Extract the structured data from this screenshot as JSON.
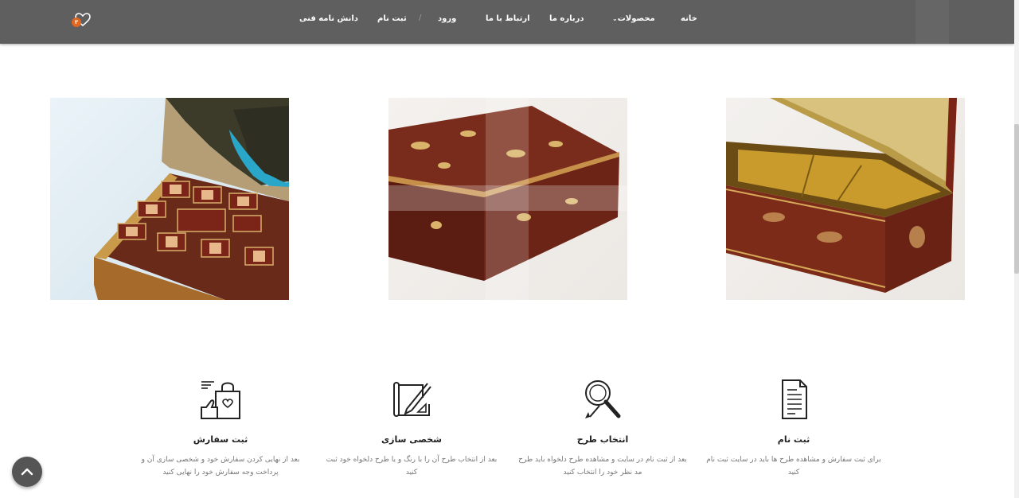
{
  "header": {
    "cart_count": "۳",
    "nav": {
      "home": "خانه",
      "products": "محصولات",
      "about": "درباره ما",
      "contact": "ارتباط با ما",
      "login": "ورود",
      "signup": "ثبت نام",
      "tech_knowledge": "دانش نامه فنی"
    }
  },
  "gallery": [
    {
      "name": "box-with-miniature-drawers"
    },
    {
      "name": "lacquered-box-hunting-scene"
    },
    {
      "name": "qatar-gold-lined-box"
    }
  ],
  "steps": [
    {
      "icon": "document-icon",
      "title": "ثبت نام",
      "text": "برای ثبت سفارش و مشاهده طرح ها باید در سایت ثبت نام کنید"
    },
    {
      "icon": "magnifier-icon",
      "title": "انتخاب طرح",
      "text": "بعد از ثبت نام در سایت و مشاهده طرح دلخواه باید طرح مد نظر خود را انتخاب کنید"
    },
    {
      "icon": "blueprint-pencil-icon",
      "title": "شخصی سازی",
      "text": "بعد از انتخاب طرح آن را با رنگ و یا طرح دلخواه خود ثبت کنید"
    },
    {
      "icon": "shopping-bag-icon",
      "title": "ثبت سفارش",
      "text": "بعد از نهایی کردن سفارش خود و شخصی سازی آن و پرداخت وجه سفارش خود را نهایی کنید"
    }
  ],
  "colors": {
    "header_bg": "#5f5f5f",
    "accent": "#e2661f"
  }
}
